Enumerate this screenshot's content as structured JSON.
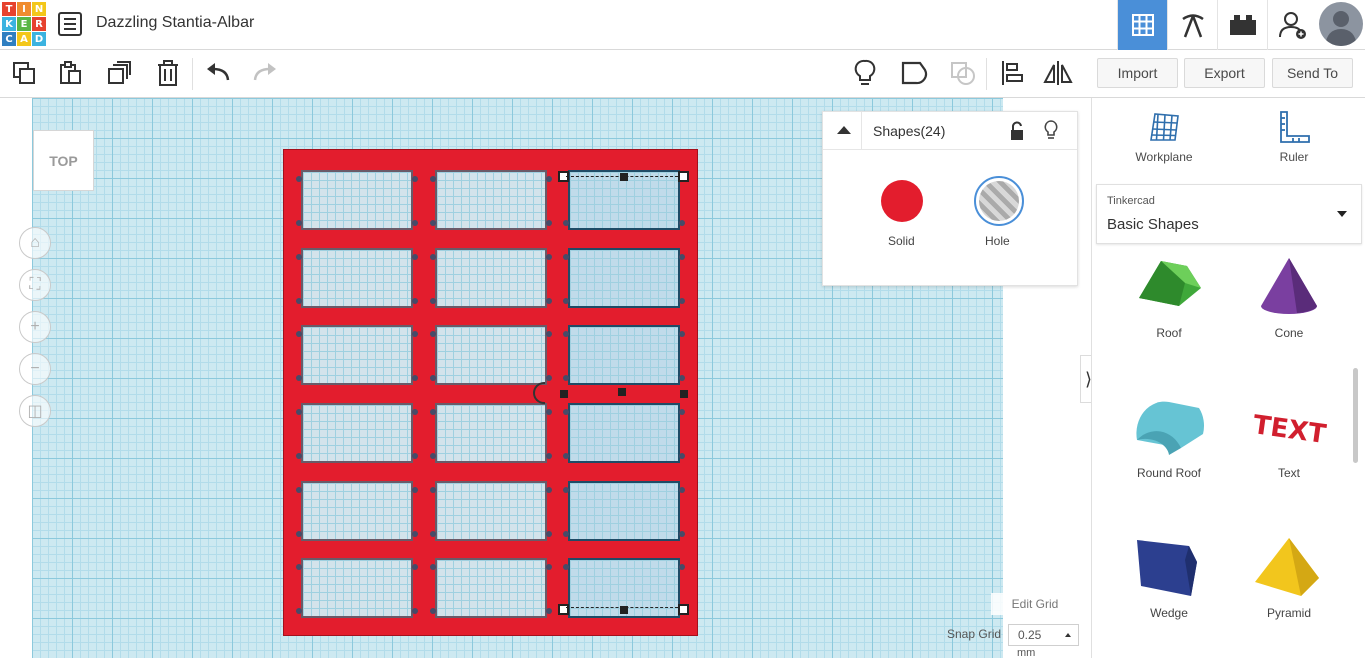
{
  "app": {
    "logo_letters": [
      "T",
      "I",
      "N",
      "K",
      "E",
      "R",
      "C",
      "A",
      "D"
    ],
    "logo_colors": [
      "#e6422e",
      "#f08c2e",
      "#f3c71a",
      "#3bb3e0",
      "#5ab645",
      "#e6422e",
      "#2f7fc1",
      "#f3c71a",
      "#3bb3e0"
    ],
    "project_title": "Dazzling Stantia-Albar"
  },
  "topnav": {
    "items": [
      "3d-design-view-icon",
      "codeblocks-pickaxe-icon",
      "bricks-lego-icon",
      "add-user-icon"
    ],
    "active_index": 0,
    "accent": "#4a8fd8"
  },
  "toolbar": {
    "import_label": "Import",
    "export_label": "Export",
    "sendto_label": "Send To"
  },
  "viewport": {
    "viewcube_label": "TOP",
    "nav_buttons": [
      "home-icon",
      "fit-view-icon",
      "zoom-in-icon",
      "zoom-out-icon",
      "perspective-icon"
    ]
  },
  "shapes_panel": {
    "title": "Shapes(24)",
    "solid_label": "Solid",
    "hole_label": "Hole",
    "solid_color": "#e31d2d"
  },
  "sidepanel": {
    "workplane_label": "Workplane",
    "ruler_label": "Ruler",
    "library_small": "Tinkercad",
    "library_name": "Basic Shapes",
    "shapes": [
      {
        "label": "Roof",
        "color": "#3fa83a"
      },
      {
        "label": "Cone",
        "color": "#7a3fa0"
      },
      {
        "label": "Round Roof",
        "color": "#66c4d4"
      },
      {
        "label": "Text",
        "color": "#d11f2e"
      },
      {
        "label": "Wedge",
        "color": "#2c3f8f"
      },
      {
        "label": "Pyramid",
        "color": "#f2c61d"
      }
    ]
  },
  "grid": {
    "edit_grid_label": "Edit Grid",
    "snap_label": "Snap Grid",
    "snap_value": "0.25",
    "snap_unit": "mm"
  },
  "model": {
    "color": "#e31d2d",
    "rows": 6,
    "cols": 3
  }
}
